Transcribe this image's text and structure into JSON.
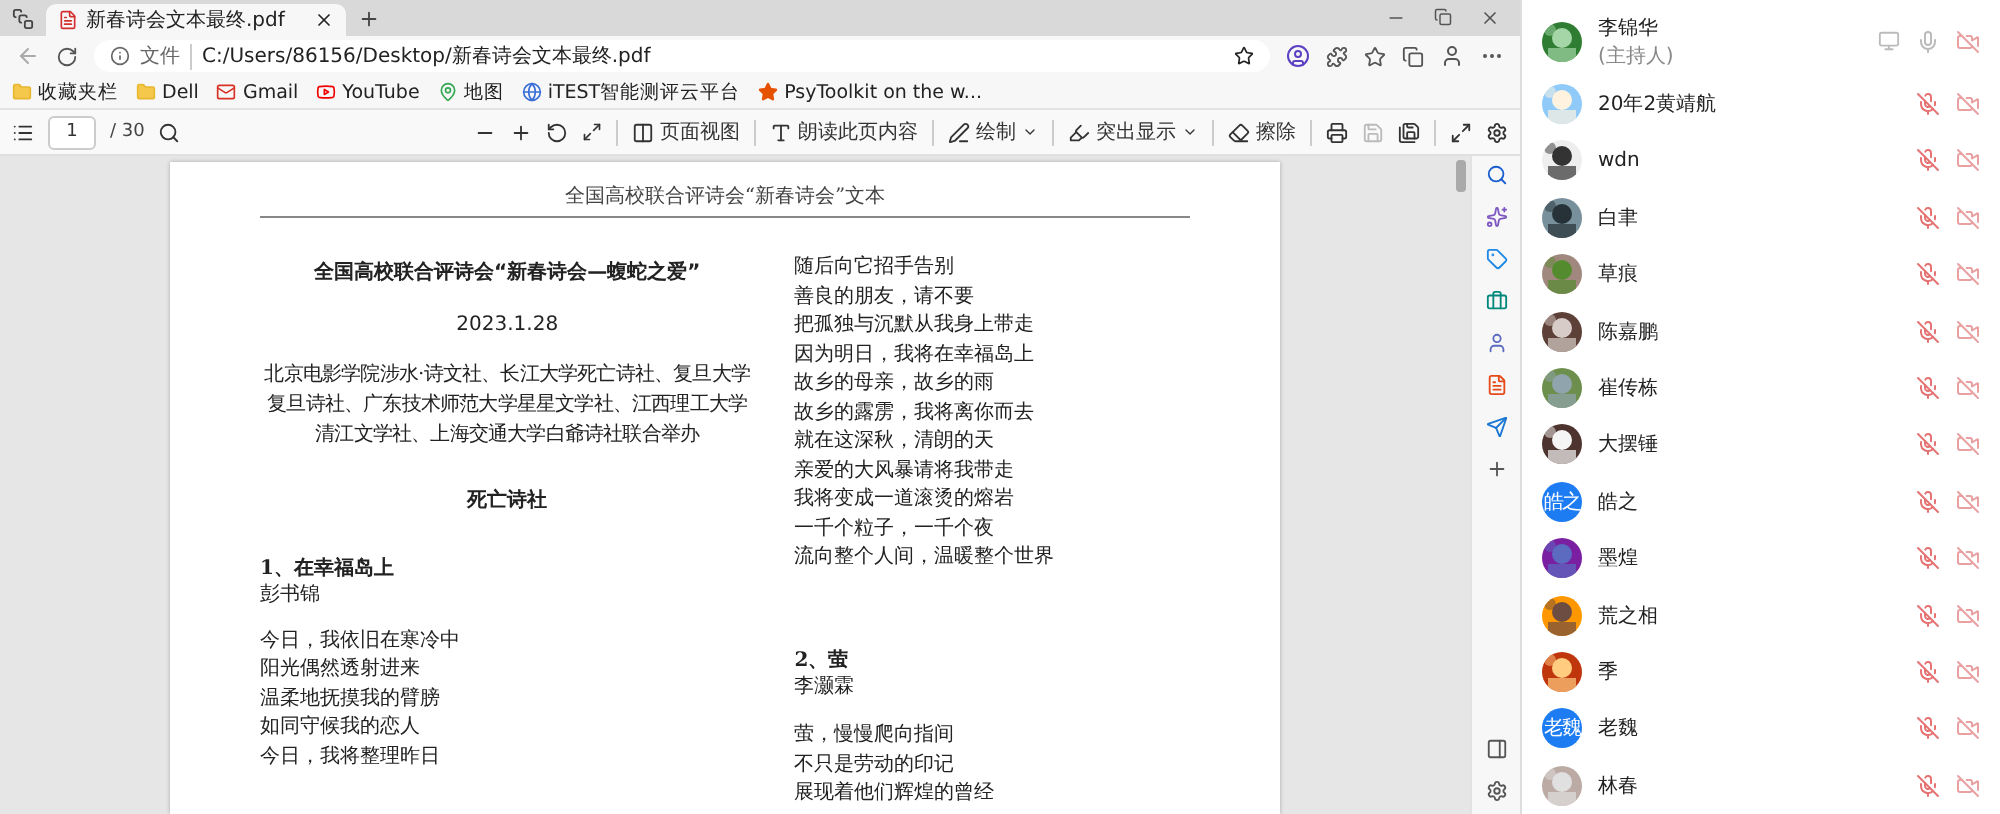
{
  "browser": {
    "tabs": [
      {
        "label": "新春诗会文本最终.pdf",
        "selected": true
      }
    ],
    "address": {
      "scheme": "文件",
      "url": "C:/Users/86156/Desktop/新春诗会文本最终.pdf"
    },
    "bookmarks": [
      {
        "label": "收藏夹栏",
        "kind": "folder"
      },
      {
        "label": "Dell",
        "kind": "folder"
      },
      {
        "label": "Gmail",
        "kind": "gmail"
      },
      {
        "label": "YouTube",
        "kind": "youtube"
      },
      {
        "label": "地图",
        "kind": "map"
      },
      {
        "label": "iTEST智能测评云平台",
        "kind": "globe"
      },
      {
        "label": "PsyToolkit on the w...",
        "kind": "star"
      }
    ]
  },
  "pdf_toolbar": {
    "page": "1",
    "page_count": "/ 30",
    "tools": [
      {
        "label": "页面视图",
        "kind": "view",
        "dropdown": false
      },
      {
        "label": "朗读此页内容",
        "kind": "read",
        "dropdown": false
      },
      {
        "label": "绘制",
        "kind": "draw",
        "dropdown": true
      },
      {
        "label": "突出显示",
        "kind": "highlight",
        "dropdown": true
      },
      {
        "label": "擦除",
        "kind": "erase",
        "dropdown": false
      }
    ]
  },
  "document": {
    "header": "全国高校联合评诗会“新春诗会”文本",
    "title": "全国高校联合评诗会“新春诗会—蝮蛇之爱”",
    "date": "2023.1.28",
    "organizers": "北京电影学院涉水·诗文社、长江大学死亡诗社、复旦大学复旦诗社、广东技术师范大学星星文学社、江西理工大学清江文学社、上海交通大学白爺诗社联合举办",
    "section": "死亡诗社",
    "left_poems": [
      {
        "title": "1、在幸福岛上",
        "author": "彭书锦",
        "lines": [
          "今日，我依旧在寒冷中",
          "阳光偶然透射进来",
          "温柔地抚摸我的臂膀",
          "如同守候我的恋人",
          "今日，我将整理昨日"
        ]
      }
    ],
    "right_lines": [
      "随后向它招手告别",
      "善良的朋友，请不要",
      "把孤独与沉默从我身上带走",
      "因为明日，我将在幸福岛上",
      "故乡的母亲，故乡的雨",
      "故乡的露雳，我将离你而去",
      "就在这深秋，清朗的天",
      "亲爱的大风暴请将我带走",
      "我将变成一道滚烫的熔岩",
      "一千个粒子，一千个夜",
      "流向整个人间，温暖整个世界"
    ],
    "right_poems": [
      {
        "title": "2、萤",
        "author": "李灏霖",
        "lines": [
          "萤，慢慢爬向指间",
          "不只是劳动的印记",
          "展现着他们辉煌的曾经"
        ]
      }
    ]
  },
  "participants": [
    {
      "name": "李锦华",
      "role": "(主持人)",
      "kind": "picture",
      "host": true,
      "mic_muted": false,
      "camera_on": false
    },
    {
      "name": "20年2黄靖航",
      "kind": "picture",
      "host": false,
      "mic_muted": true,
      "camera_on": false
    },
    {
      "name": "wdn",
      "kind": "picture",
      "host": false,
      "mic_muted": true,
      "camera_on": false
    },
    {
      "name": "白聿",
      "kind": "picture",
      "host": false,
      "mic_muted": true,
      "camera_on": false
    },
    {
      "name": "草痕",
      "kind": "picture",
      "host": false,
      "mic_muted": true,
      "camera_on": false
    },
    {
      "name": "陈嘉鹏",
      "kind": "picture",
      "host": false,
      "mic_muted": true,
      "camera_on": false
    },
    {
      "name": "崔传栋",
      "kind": "picture",
      "host": false,
      "mic_muted": true,
      "camera_on": false
    },
    {
      "name": "大摆锤",
      "kind": "picture",
      "host": false,
      "mic_muted": true,
      "camera_on": false
    },
    {
      "name": "皓之",
      "kind": "initials",
      "avatar_text": "皓之",
      "host": false,
      "mic_muted": true,
      "camera_on": false
    },
    {
      "name": "墨煌",
      "kind": "picture",
      "host": false,
      "mic_muted": true,
      "camera_on": false
    },
    {
      "name": "荒之相",
      "kind": "picture",
      "host": false,
      "mic_muted": true,
      "camera_on": false
    },
    {
      "name": "季",
      "kind": "picture",
      "host": false,
      "mic_muted": true,
      "camera_on": false
    },
    {
      "name": "老魏",
      "kind": "initials",
      "avatar_text": "老魏",
      "host": false,
      "mic_muted": true,
      "camera_on": false
    },
    {
      "name": "林春",
      "kind": "picture",
      "host": false,
      "mic_muted": true,
      "camera_on": false
    }
  ]
}
